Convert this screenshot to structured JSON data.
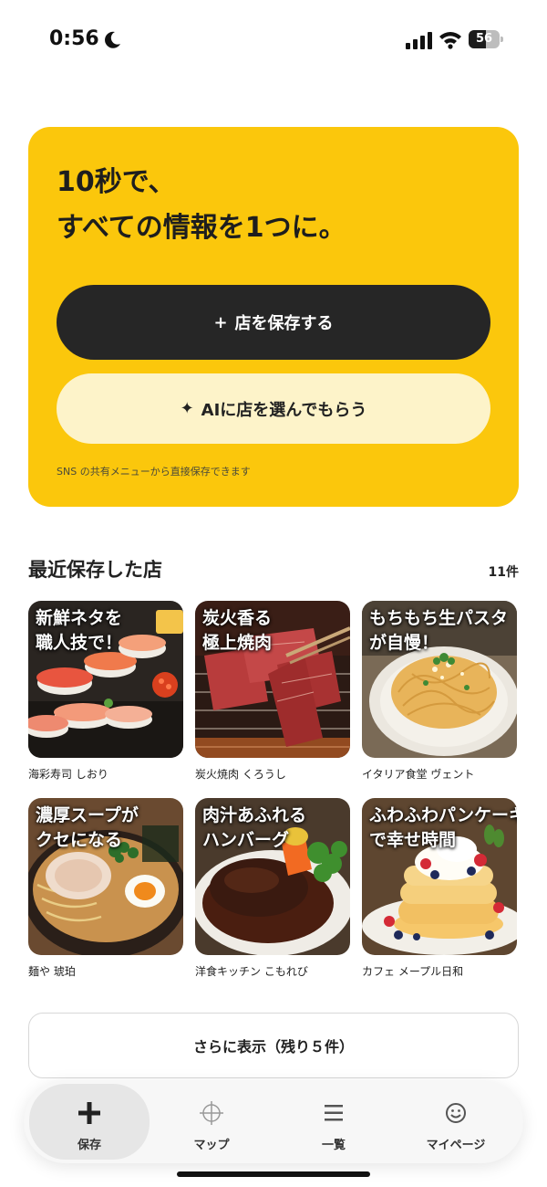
{
  "status_bar": {
    "time": "0:56",
    "battery": "56",
    "battery_level": 0.56
  },
  "hero": {
    "title_line1": "10秒で、",
    "title_line2": "すべての情報を1つに。",
    "save_button": {
      "icon": "+",
      "label": "店を保存する"
    },
    "ai_button": {
      "icon": "✦",
      "label": "AIに店を選んでもらう"
    },
    "hint": "SNS の共有メニューから直接保存できます"
  },
  "recent": {
    "title": "最近保存した店",
    "count": "11件",
    "shops": [
      {
        "caption_line1": "新鮮ネタを",
        "caption_line2": "職人技で！",
        "name": "海彩寿司 しおり",
        "image": "sushi-photo"
      },
      {
        "caption_line1": "炭火香る",
        "caption_line2": "極上焼肉",
        "name": "炭火焼肉 くろうし",
        "image": "yakiniku-photo"
      },
      {
        "caption_line1": "もちもち生パスタ",
        "caption_line2": "が自慢！",
        "name": "イタリア食堂 ヴェント",
        "image": "pasta-photo"
      },
      {
        "caption_line1": "濃厚スープが",
        "caption_line2": "クセになる",
        "name": "麺や 琥珀",
        "image": "ramen-photo"
      },
      {
        "caption_line1": "肉汁あふれる",
        "caption_line2": "ハンバーグ",
        "name": "洋食キッチン こもれび",
        "image": "hamburg-photo"
      },
      {
        "caption_line1": "ふわふわパンケーキ",
        "caption_line2": "で幸せ時間",
        "name": "カフェ メープル日和",
        "image": "pancake-photo"
      }
    ]
  },
  "more_button": {
    "label": "さらに表示（残り５件）"
  },
  "nav": {
    "items": [
      {
        "label": "保存",
        "icon": "plus-icon",
        "active": true
      },
      {
        "label": "マップ",
        "icon": "crosshair-icon",
        "active": false
      },
      {
        "label": "一覧",
        "icon": "list-icon",
        "active": false
      },
      {
        "label": "マイページ",
        "icon": "smile-icon",
        "active": false
      }
    ]
  },
  "colors": {
    "accent": "#fbc70c",
    "dark_button": "#262626",
    "light_button": "#fdf3c9"
  }
}
